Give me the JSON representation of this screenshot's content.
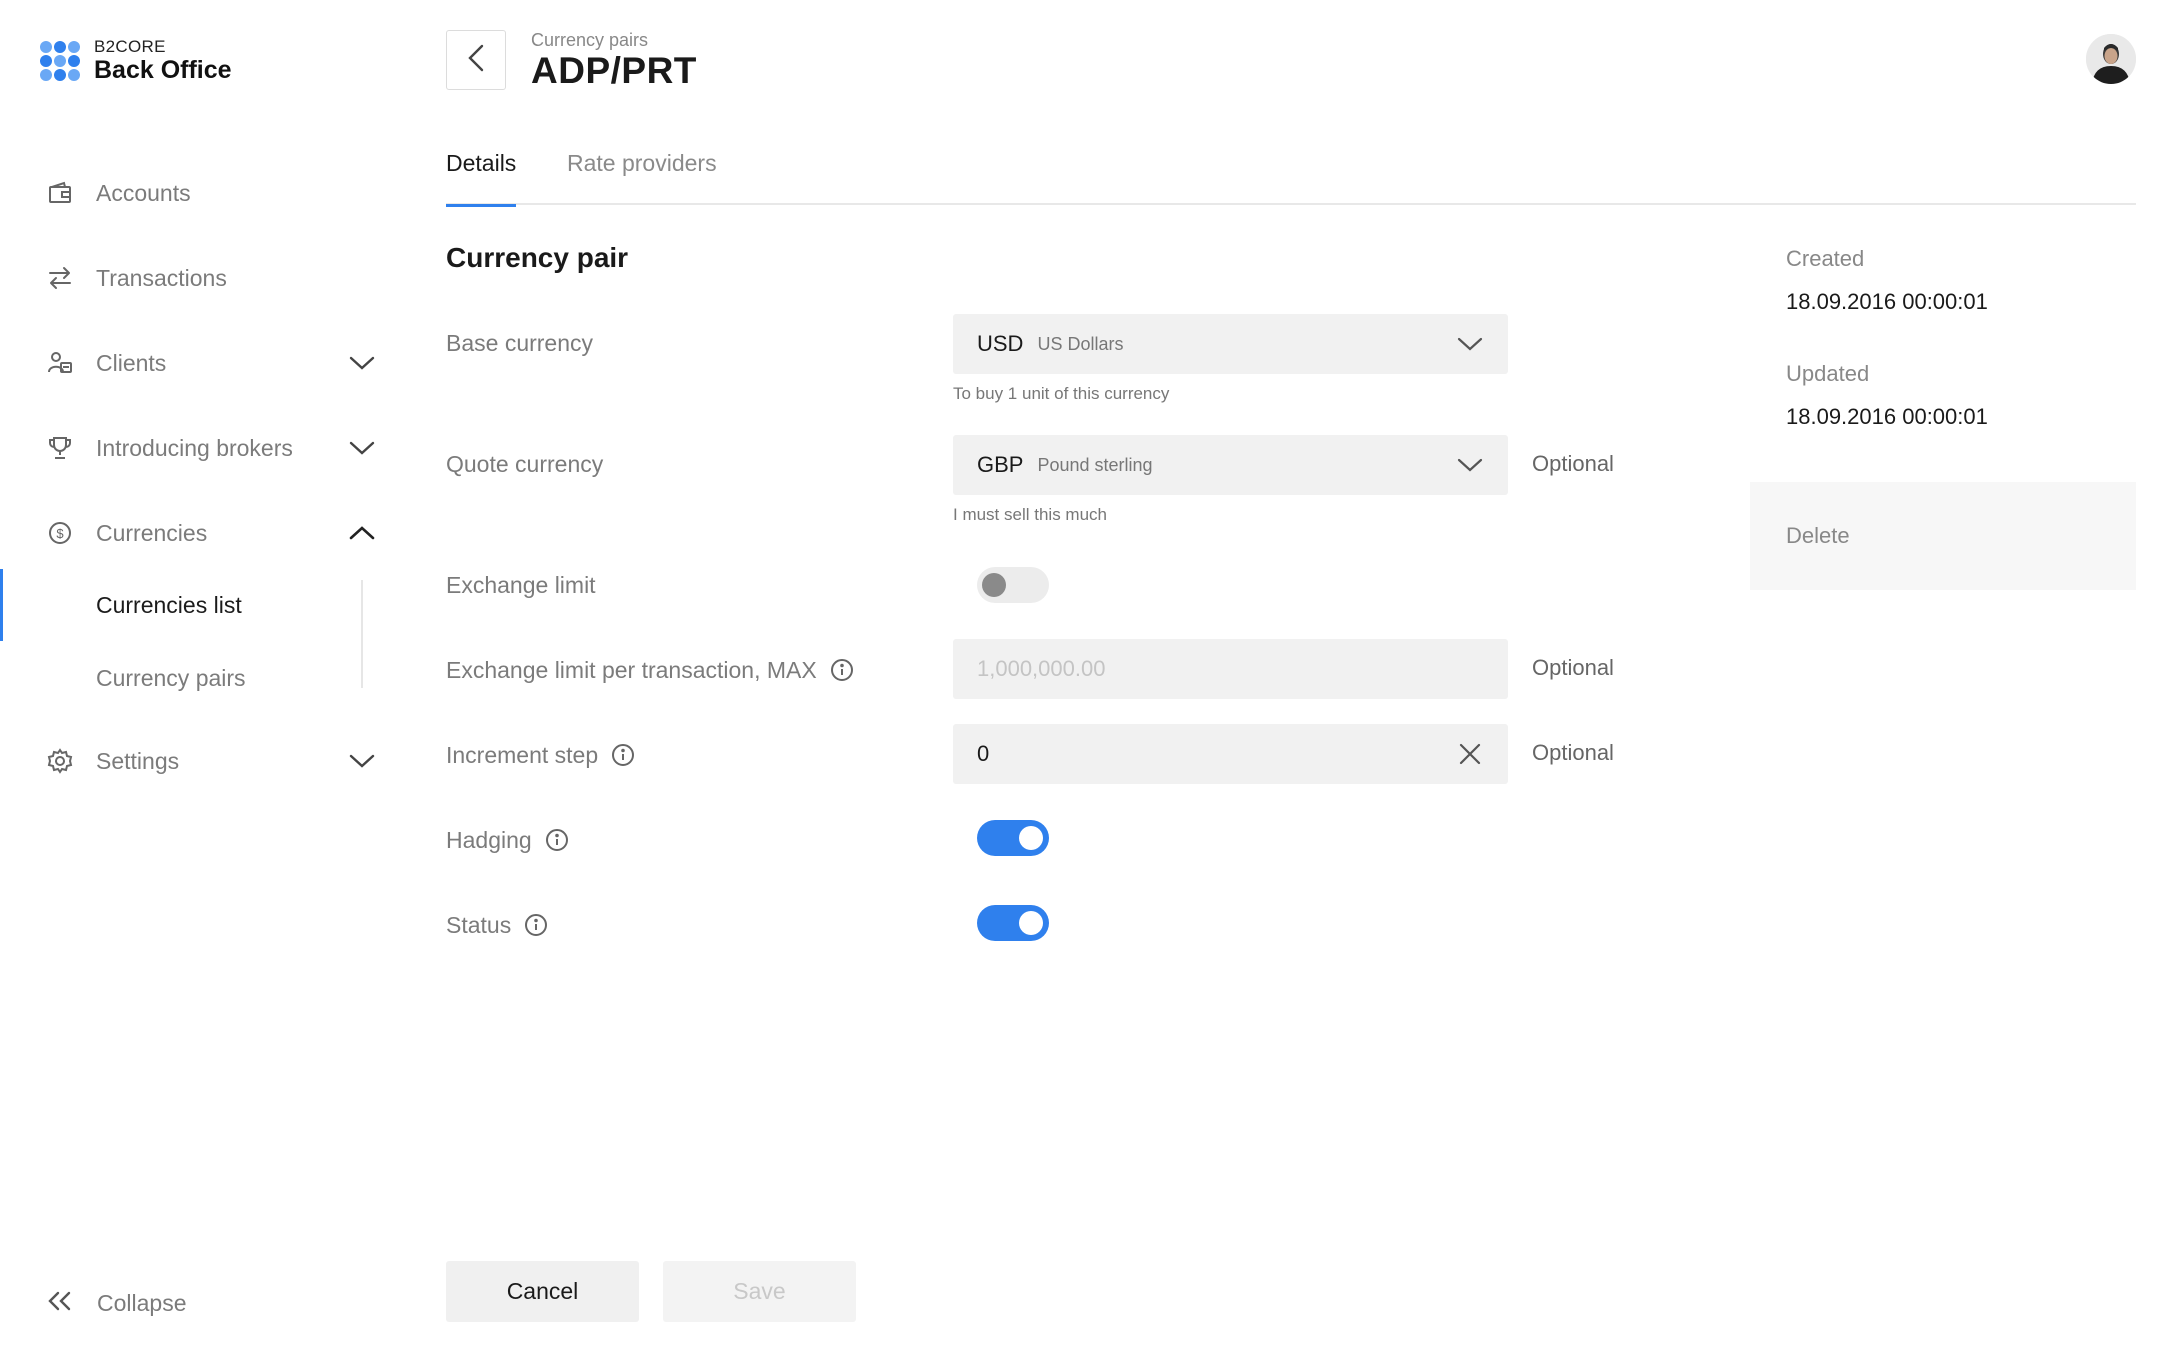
{
  "brand": {
    "small": "B2CORE",
    "big": "Back Office"
  },
  "sidebar": {
    "items": [
      {
        "label": "Accounts",
        "icon": "wallet-icon"
      },
      {
        "label": "Transactions",
        "icon": "swap-arrows-icon"
      },
      {
        "label": "Clients",
        "icon": "clients-icon",
        "expandable": true
      },
      {
        "label": "Introducing brokers",
        "icon": "trophy-icon",
        "expandable": true
      },
      {
        "label": "Currencies",
        "icon": "dollar-circle-icon",
        "expanded": true
      },
      {
        "label": "Settings",
        "icon": "gear-icon",
        "expandable": true
      }
    ],
    "subitems": [
      {
        "label": "Currencies list",
        "active": true
      },
      {
        "label": "Currency pairs",
        "active": false
      }
    ],
    "collapse_label": "Collapse"
  },
  "header": {
    "breadcrumb": "Currency pairs",
    "title": "ADP/PRT"
  },
  "tabs": [
    {
      "label": "Details",
      "active": true
    },
    {
      "label": "Rate providers",
      "active": false
    }
  ],
  "form": {
    "section_title": "Currency pair",
    "base_currency": {
      "label": "Base currency",
      "code": "USD",
      "name": "US Dollars",
      "hint": "To buy 1 unit of this currency"
    },
    "quote_currency": {
      "label": "Quote currency",
      "code": "GBP",
      "name": "Pound sterling",
      "hint": "I must sell this much",
      "optional": "Optional"
    },
    "exchange_limit": {
      "label": "Exchange limit",
      "enabled": false
    },
    "exchange_limit_max": {
      "label": "Exchange limit per transaction, MAX",
      "placeholder": "1,000,000.00",
      "optional": "Optional"
    },
    "increment_step": {
      "label": "Increment step",
      "value": "0",
      "optional": "Optional"
    },
    "hadging": {
      "label": "Hadging",
      "enabled": true
    },
    "status": {
      "label": "Status",
      "enabled": true
    }
  },
  "meta": {
    "created_label": "Created",
    "created_value": "18.09.2016 00:00:01",
    "updated_label": "Updated",
    "updated_value": "18.09.2016 00:00:01",
    "delete_label": "Delete"
  },
  "actions": {
    "cancel": "Cancel",
    "save": "Save"
  },
  "colors": {
    "accent": "#2f80ed",
    "field_bg": "#f1f1f1",
    "muted_text": "#7b7b7b"
  }
}
